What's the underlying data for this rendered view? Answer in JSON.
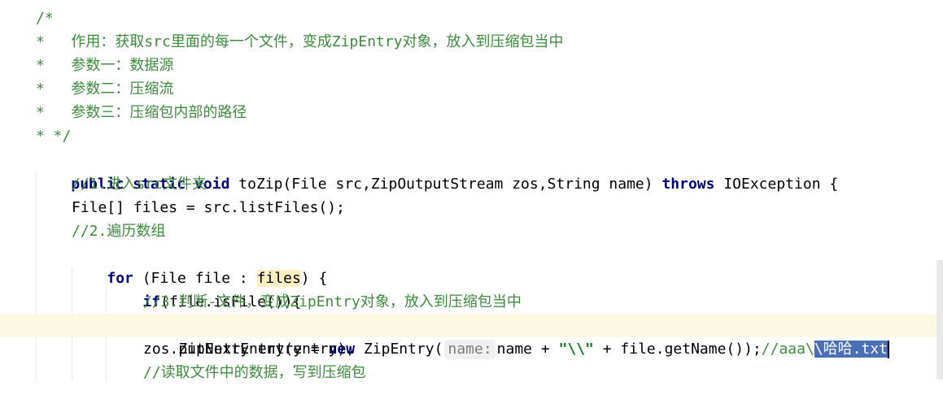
{
  "editor": {
    "lines": [
      {
        "id": "l1",
        "text": "/*"
      },
      {
        "id": "l2",
        "text": "*   作用：获取src里面的每一个文件，变成ZipEntry对象，放入到压缩包当中"
      },
      {
        "id": "l3",
        "text": "*   参数一：数据源"
      },
      {
        "id": "l4",
        "text": "*   参数二：压缩流"
      },
      {
        "id": "l5",
        "text": "*   参数三：压缩包内部的路径"
      },
      {
        "id": "l6",
        "text": "* */"
      },
      {
        "id": "l7a",
        "text": "public static void"
      },
      {
        "id": "l7b",
        "text": " toZip(File src,ZipOutputStream zos,String name) "
      },
      {
        "id": "l7c",
        "text": "throws"
      },
      {
        "id": "l7d",
        "text": " IOException {"
      },
      {
        "id": "l8",
        "text": "//1.进入src文件夹"
      },
      {
        "id": "l9",
        "text": "File[] files = src.listFiles();"
      },
      {
        "id": "l10",
        "text": "//2.遍历数组"
      },
      {
        "id": "l11a",
        "text": "for"
      },
      {
        "id": "l11b",
        "text": " (File file : "
      },
      {
        "id": "l11c",
        "text": "files"
      },
      {
        "id": "l11d",
        "text": ") {"
      },
      {
        "id": "l12a",
        "text": "if"
      },
      {
        "id": "l12b",
        "text": "(file.isFile()){"
      },
      {
        "id": "l13",
        "text": "//3.判断-文件，变成ZipEntry对象，放入到压缩包当中"
      },
      {
        "id": "l14a",
        "text": "ZipEntry entry = "
      },
      {
        "id": "l14b",
        "text": "new"
      },
      {
        "id": "l14c",
        "text": " ZipEntry("
      },
      {
        "id": "l14hint",
        "text": "name:"
      },
      {
        "id": "l14d",
        "text": "name + "
      },
      {
        "id": "l14e",
        "text": "\"\\\\\""
      },
      {
        "id": "l14f",
        "text": " + file.getName());"
      },
      {
        "id": "l14g",
        "text": "//aaa\\"
      },
      {
        "id": "l14h",
        "text": "\\哈哈.txt"
      },
      {
        "id": "l15",
        "text": "zos.putNextEntry(entry);"
      },
      {
        "id": "l16",
        "text": "//读取文件中的数据，写到压缩包"
      }
    ]
  },
  "colors": {
    "comment": "#3d8b3d",
    "keyword": "#00007f",
    "selection": "#4a6fb5",
    "current_line": "#fcf8e3"
  },
  "icons": {
    "gutter": "lightbulb-icon"
  }
}
